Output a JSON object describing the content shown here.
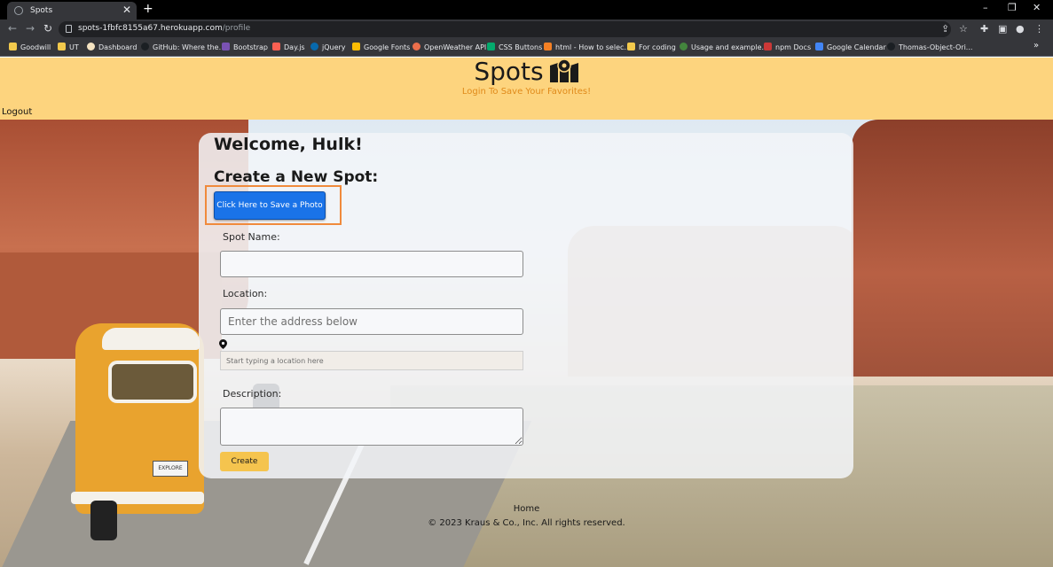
{
  "browser": {
    "tab_title": "Spots",
    "new_tab": "+",
    "close_tab": "✕",
    "url_host": "spots-1fbfc8155a67.herokuapp.com",
    "url_path": "/profile",
    "window_controls": [
      "–",
      "❐",
      "✕"
    ],
    "bookmarks": [
      {
        "label": "Goodwill",
        "color": "#f2c94c"
      },
      {
        "label": "UT",
        "color": "#f2c94c"
      },
      {
        "label": "Dashboard",
        "color": "#f4e3c1"
      },
      {
        "label": "GitHub: Where the...",
        "color": "#1b1f23"
      },
      {
        "label": "Bootstrap",
        "color": "#7952b3"
      },
      {
        "label": "Day.js",
        "color": "#fb6052"
      },
      {
        "label": "jQuery",
        "color": "#0769ad"
      },
      {
        "label": "Google Fonts",
        "color": "#fbbc04"
      },
      {
        "label": "OpenWeather API",
        "color": "#eb6e4b"
      },
      {
        "label": "CSS Buttons",
        "color": "#04aa6d"
      },
      {
        "label": "html - How to selec...",
        "color": "#f48024"
      },
      {
        "label": "For coding",
        "color": "#f2c94c"
      },
      {
        "label": "Usage and example...",
        "color": "#43853d"
      },
      {
        "label": "npm Docs",
        "color": "#cb3837"
      },
      {
        "label": "Google Calendar",
        "color": "#4285f4"
      },
      {
        "label": "Thomas-Object-Ori...",
        "color": "#1b1f23"
      }
    ],
    "more_bookmarks": "»"
  },
  "header": {
    "title": "Spots",
    "subtitle": "Login To Save Your Favorites!",
    "logout": "Logout",
    "accent": "#fdd47e",
    "subtitle_color": "#e08a1a"
  },
  "form": {
    "welcome": "Welcome, Hulk!",
    "create_heading": "Create a New Spot:",
    "photo_button": "Click Here to Save a Photo",
    "spot_name_label": "Spot Name:",
    "spot_name_value": "",
    "location_label": "Location:",
    "location_placeholder": "Enter the address below",
    "location_search_placeholder": "Start typing a location here",
    "description_label": "Description:",
    "description_value": "",
    "create_button": "Create",
    "photo_button_color": "#1a73e8",
    "create_button_color": "#f5c44e",
    "highlight_color": "#f08a3c"
  },
  "scene": {
    "plate_text": "EXPLORE"
  },
  "footer": {
    "home": "Home",
    "copyright": "© 2023 Kraus & Co., Inc. All rights reserved."
  }
}
